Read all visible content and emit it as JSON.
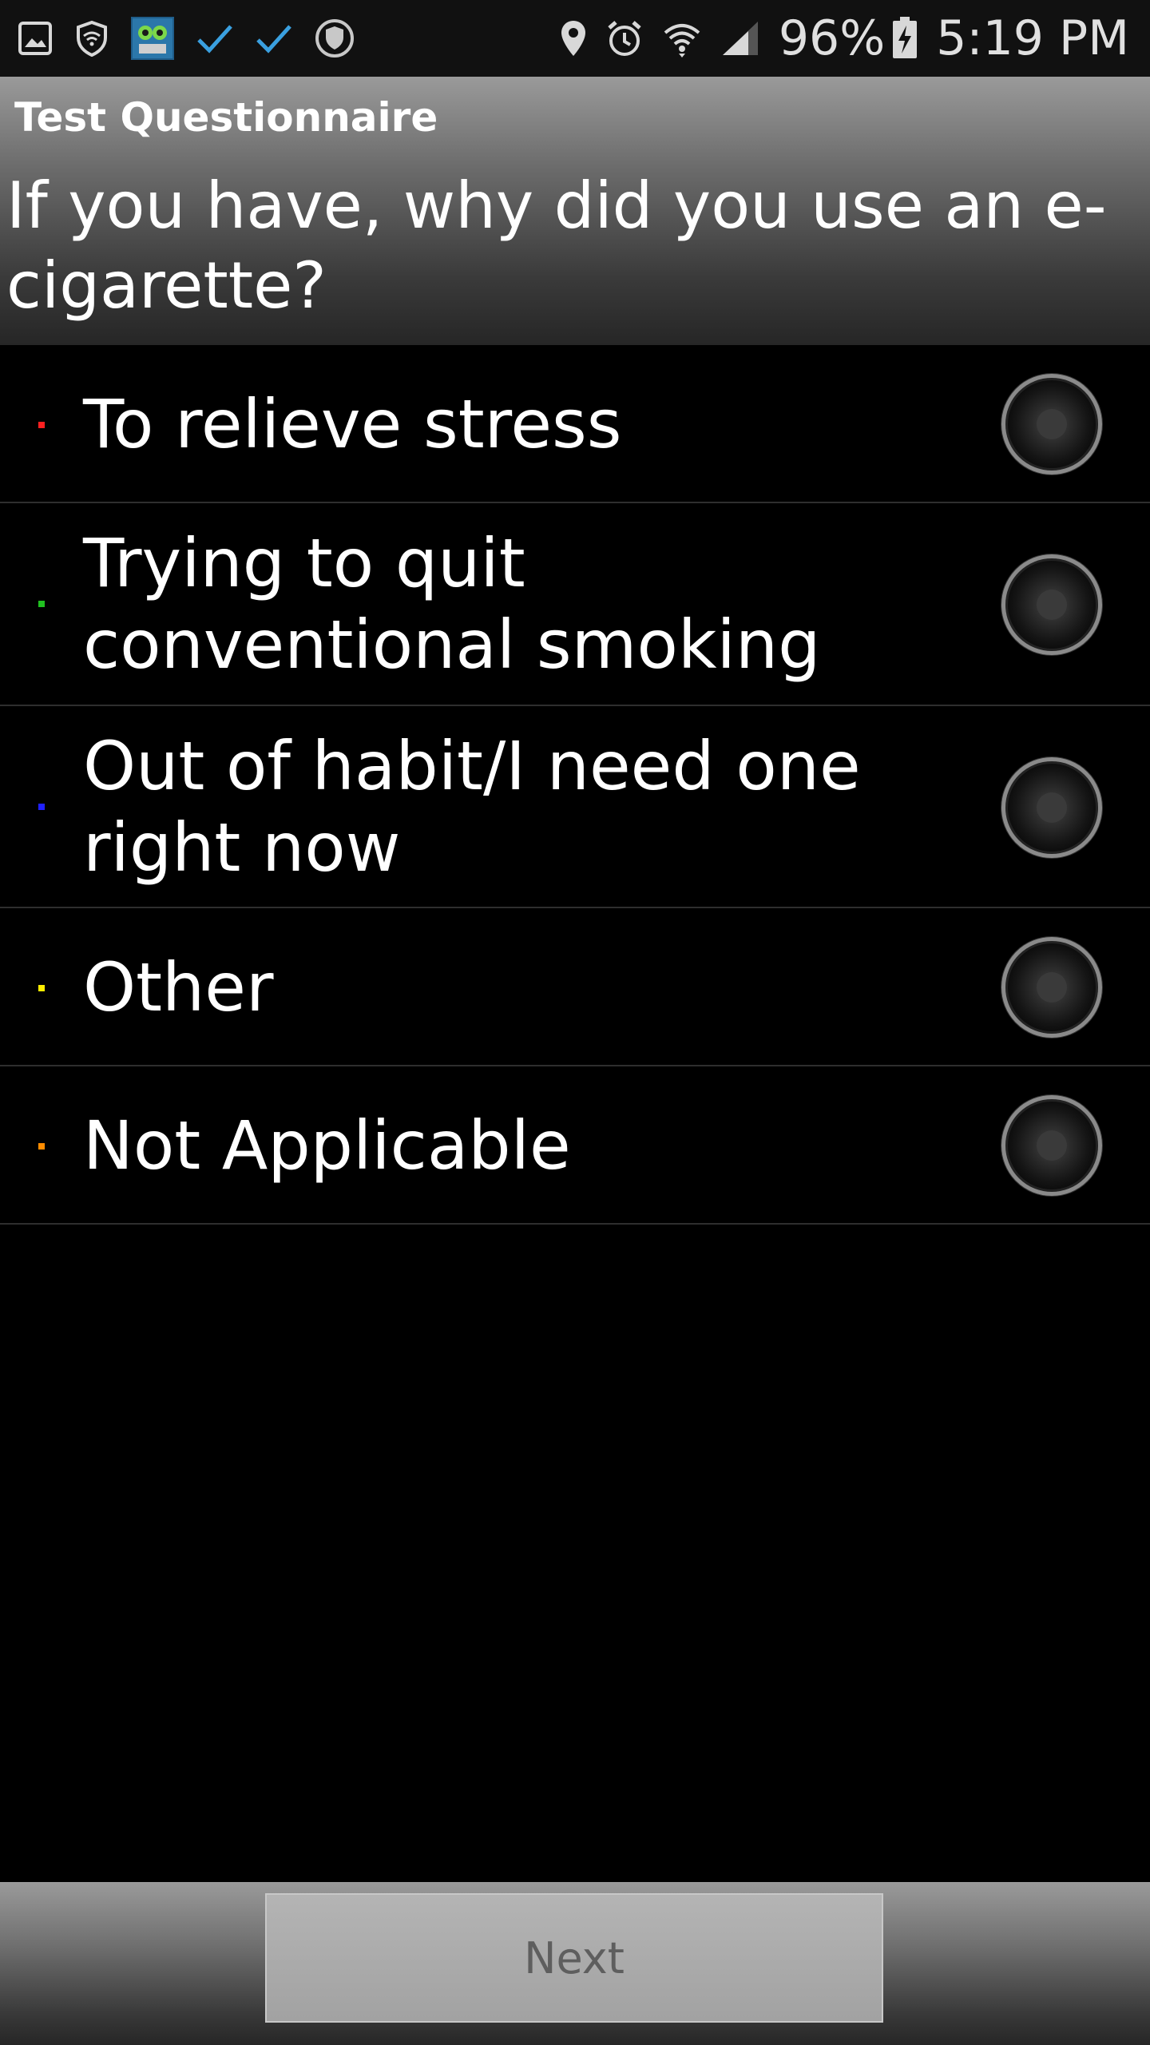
{
  "status_bar": {
    "left_icons": [
      "gallery-icon",
      "shield-wifi-icon",
      "app-thumbnail-icon",
      "checkmark-icon",
      "checkmark-icon",
      "security-shield-icon"
    ],
    "right_icons": [
      "location-pin-icon",
      "alarm-clock-icon",
      "wifi-icon",
      "cell-signal-icon",
      "battery-charging-icon"
    ],
    "battery": "96%",
    "time": "5:19 PM"
  },
  "header": {
    "title": "Test Questionnaire",
    "question": "If you have, why did you use an e-cigarette?"
  },
  "options": [
    {
      "label": "To relieve stress",
      "dot_color": "#ff2020",
      "selected": false
    },
    {
      "label": "Trying to quit conventional smoking",
      "dot_color": "#20c020",
      "selected": false
    },
    {
      "label": "Out of habit/I need one right now",
      "dot_color": "#2020ff",
      "selected": false
    },
    {
      "label": "Other",
      "dot_color": "#ffee00",
      "selected": false
    },
    {
      "label": "Not Applicable",
      "dot_color": "#ff8c00",
      "selected": false
    }
  ],
  "footer": {
    "next_label": "Next",
    "next_enabled": false
  }
}
